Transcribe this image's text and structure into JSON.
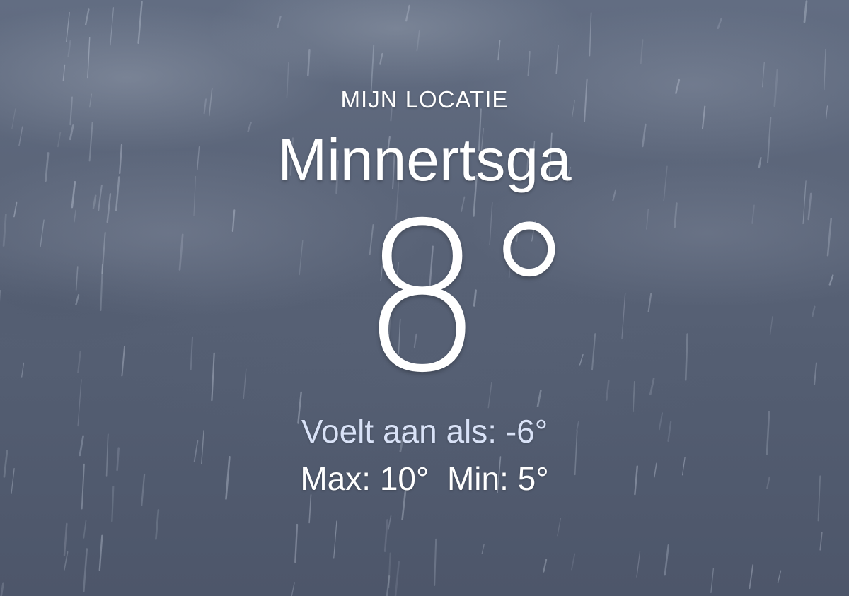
{
  "weather": {
    "location_label": "MIJN LOCATIE",
    "city": "Minnertsga",
    "temperature": "8°",
    "feels_like": "Voelt aan als: -6°",
    "max": "Max: 10°",
    "min": "Min: 5°"
  },
  "theme": {
    "background": "#5a6478",
    "text": "#ffffff",
    "feels_like_color": "#d9e2f7",
    "condition_icon": "rain-background"
  }
}
